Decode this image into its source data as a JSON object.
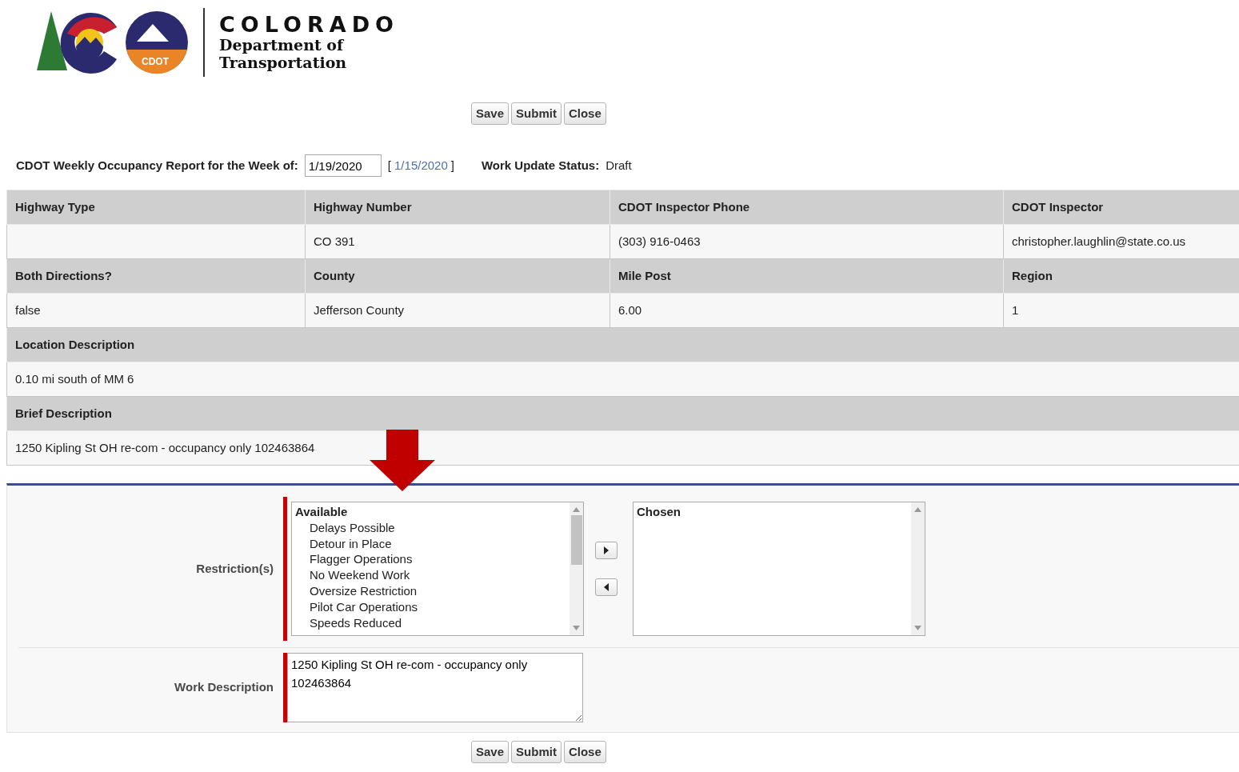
{
  "logo": {
    "wordmark": "COLORADO",
    "line1": "Department of",
    "line2": "Transportation",
    "badge": "CDOT"
  },
  "buttons_top": [
    "Save",
    "Submit",
    "Close"
  ],
  "report": {
    "label": "CDOT Weekly Occupancy Report for the Week of:",
    "week_value": "1/19/2020",
    "bracket_open": "[",
    "date_link": "1/15/2020",
    "bracket_close": "]",
    "status_label": "Work Update Status:",
    "status": "Draft"
  },
  "details": [
    {
      "kind": "header",
      "cells": [
        "Highway Type",
        "Highway Number",
        "CDOT Inspector Phone",
        "CDOT Inspector"
      ]
    },
    {
      "kind": "value",
      "cells": [
        null,
        "CO 391",
        "(303) 916-0463",
        "christopher.laughlin@state.co.us"
      ]
    },
    {
      "kind": "header",
      "cells": [
        "Both Directions?",
        "County",
        "Mile Post",
        "Region"
      ]
    },
    {
      "kind": "value",
      "cells": [
        "false",
        "Jefferson County",
        "6.00",
        "1"
      ]
    },
    {
      "kind": "header",
      "cells": [
        "Location Description"
      ]
    },
    {
      "kind": "value",
      "cells": [
        "0.10 mi south of MM 6"
      ]
    },
    {
      "kind": "header",
      "cells": [
        "Brief Description"
      ]
    },
    {
      "kind": "value",
      "cells": [
        "1250 Kipling St OH re-com - occupancy only 102463864"
      ]
    }
  ],
  "form": {
    "restrictions": {
      "label": "Restriction(s)",
      "required": true,
      "available": {
        "title": "Available",
        "items": [
          "Delays Possible",
          "Detour in Place",
          "Flagger Operations",
          "No Weekend Work",
          "Oversize Restriction",
          "Pilot Car Operations",
          "Speeds Reduced"
        ]
      },
      "chosen": {
        "title": "Chosen"
      }
    },
    "work_description": {
      "label": "Work Description",
      "required": true,
      "value": "1250 Kipling St OH re-com - occupancy only 102463864"
    }
  },
  "buttons_bottom": [
    "Save",
    "Submit",
    "Close"
  ]
}
